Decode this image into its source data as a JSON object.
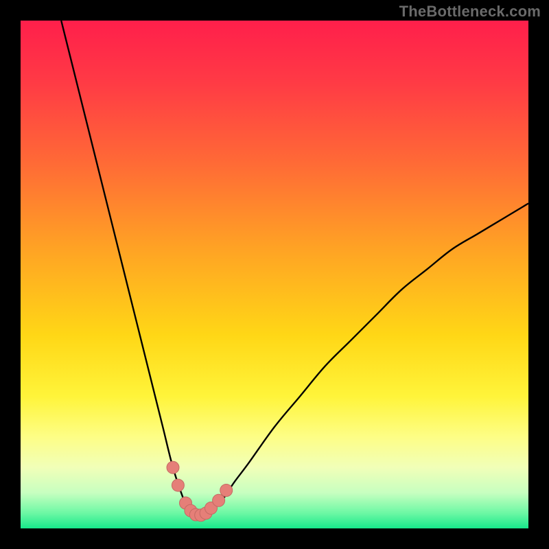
{
  "watermark": {
    "text": "TheBottleneck.com"
  },
  "colors": {
    "black": "#000000",
    "curve": "#000000",
    "marker_fill": "#e57f78",
    "marker_stroke": "#c46a63",
    "gradient_stops": [
      {
        "offset": 0.0,
        "color": "#ff1f4b"
      },
      {
        "offset": 0.12,
        "color": "#ff3a45"
      },
      {
        "offset": 0.28,
        "color": "#ff6a36"
      },
      {
        "offset": 0.45,
        "color": "#ffa324"
      },
      {
        "offset": 0.62,
        "color": "#ffd716"
      },
      {
        "offset": 0.74,
        "color": "#fff43a"
      },
      {
        "offset": 0.82,
        "color": "#fdfe86"
      },
      {
        "offset": 0.88,
        "color": "#f1ffb8"
      },
      {
        "offset": 0.93,
        "color": "#c7ffc0"
      },
      {
        "offset": 0.97,
        "color": "#6cf8a4"
      },
      {
        "offset": 1.0,
        "color": "#17e88b"
      }
    ]
  },
  "chart_data": {
    "type": "line",
    "title": "",
    "xlabel": "",
    "ylabel": "",
    "xlim": [
      0,
      100
    ],
    "ylim": [
      0,
      100
    ],
    "grid": false,
    "legend": false,
    "series": [
      {
        "name": "bottleneck-curve",
        "x": [
          8,
          10,
          12,
          15,
          18,
          20,
          22,
          24,
          26,
          28,
          30,
          32,
          33,
          34,
          35,
          36,
          37,
          38,
          40,
          42,
          45,
          50,
          55,
          60,
          65,
          70,
          75,
          80,
          85,
          90,
          95,
          100
        ],
        "y": [
          100,
          92,
          84,
          72,
          60,
          52,
          44,
          36,
          28,
          20,
          12,
          6,
          4,
          3,
          2.5,
          2.5,
          3,
          4,
          6,
          9,
          13,
          20,
          26,
          32,
          37,
          42,
          47,
          51,
          55,
          58,
          61,
          64
        ]
      }
    ],
    "markers": [
      {
        "x": 30,
        "y": 12
      },
      {
        "x": 31,
        "y": 8.5
      },
      {
        "x": 32.5,
        "y": 5
      },
      {
        "x": 33.5,
        "y": 3.5
      },
      {
        "x": 34.5,
        "y": 2.7
      },
      {
        "x": 35.5,
        "y": 2.6
      },
      {
        "x": 36.5,
        "y": 3
      },
      {
        "x": 37.5,
        "y": 4
      },
      {
        "x": 39,
        "y": 5.5
      },
      {
        "x": 40.5,
        "y": 7.5
      }
    ]
  }
}
